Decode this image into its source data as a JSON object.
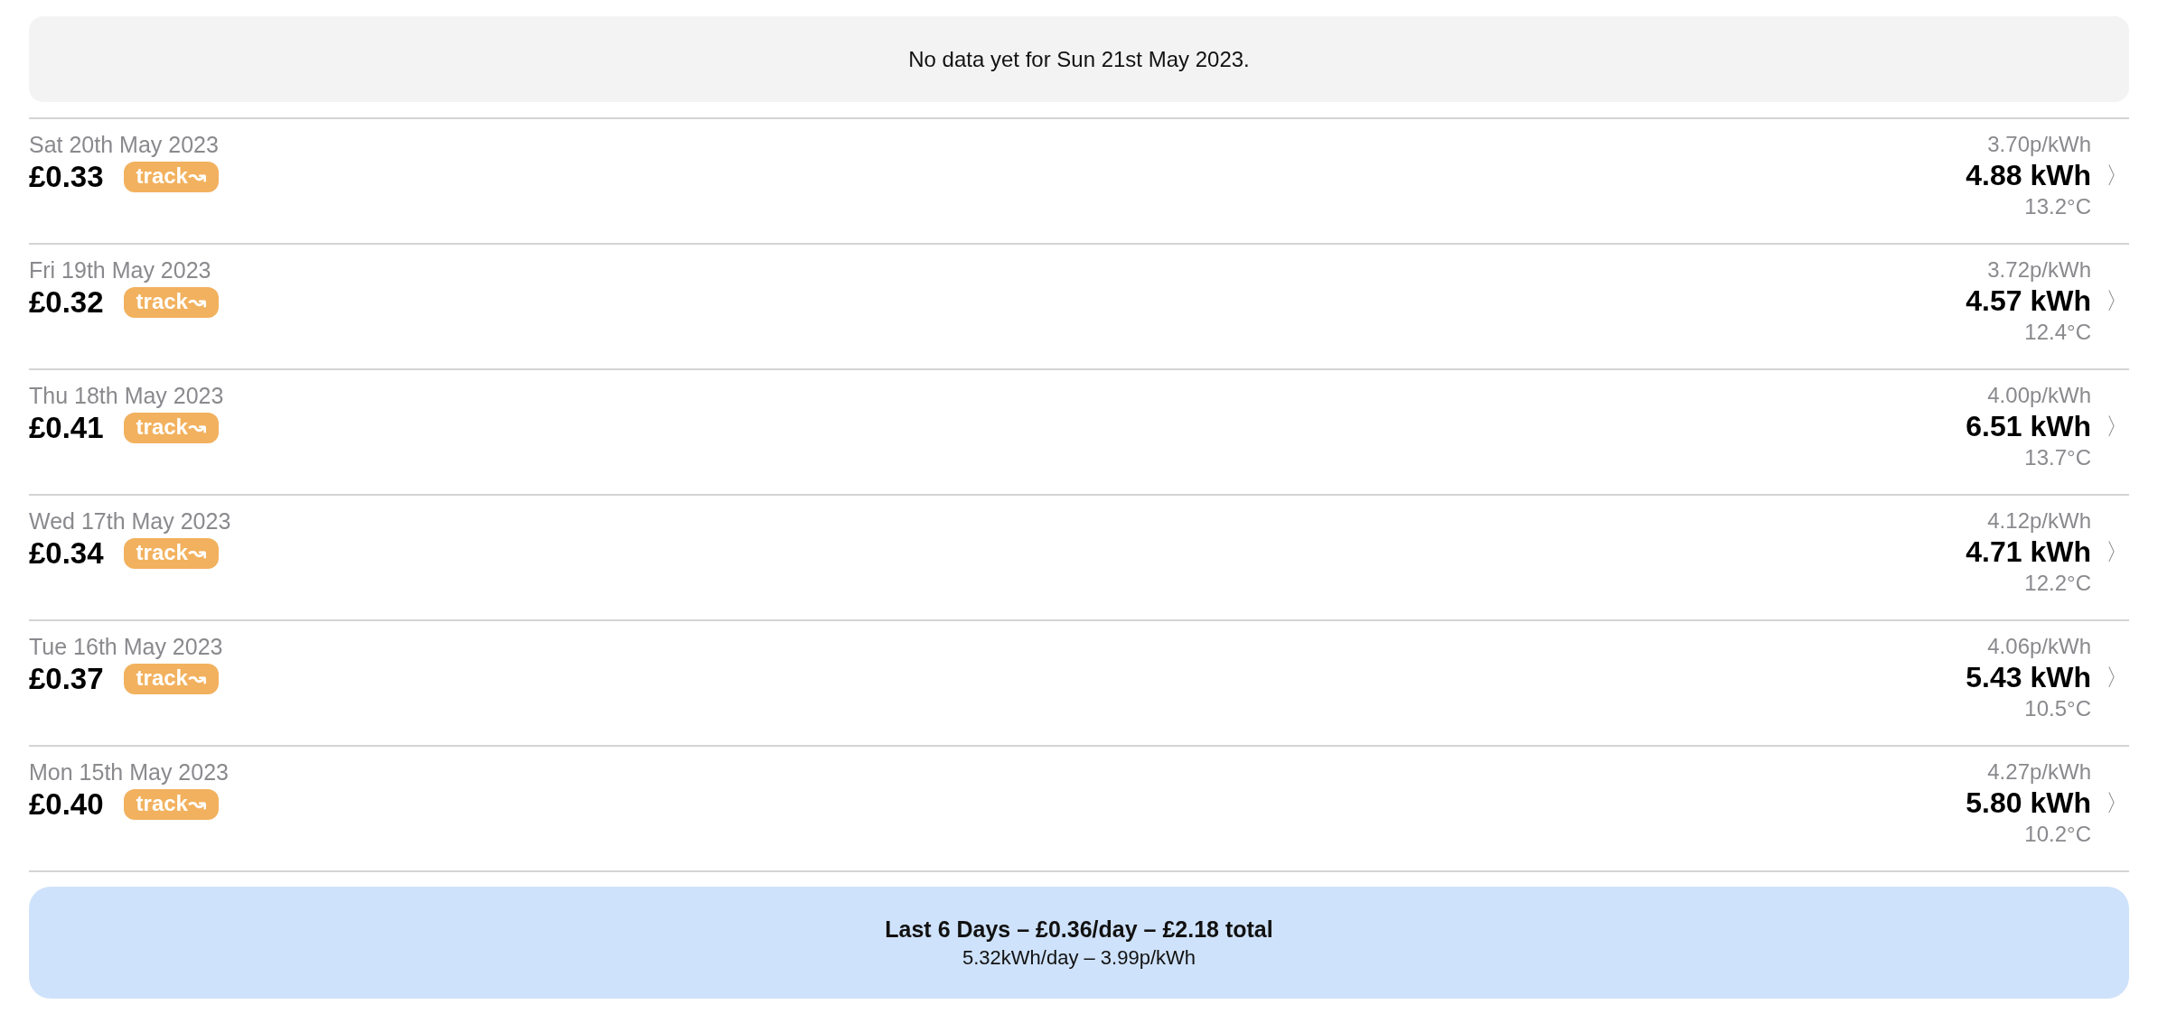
{
  "notice": "No data yet for Sun 21st May 2023.",
  "days": [
    {
      "date": "Sat 20th May 2023",
      "cost": "£0.33",
      "badge": "track↝",
      "rate": "3.70p/kWh",
      "usage": "4.88 kWh",
      "temperature": "13.2°C",
      "chevron": "〉"
    },
    {
      "date": "Fri 19th May 2023",
      "cost": "£0.32",
      "badge": "track↝",
      "rate": "3.72p/kWh",
      "usage": "4.57 kWh",
      "temperature": "12.4°C",
      "chevron": "〉"
    },
    {
      "date": "Thu 18th May 2023",
      "cost": "£0.41",
      "badge": "track↝",
      "rate": "4.00p/kWh",
      "usage": "6.51 kWh",
      "temperature": "13.7°C",
      "chevron": "〉"
    },
    {
      "date": "Wed 17th May 2023",
      "cost": "£0.34",
      "badge": "track↝",
      "rate": "4.12p/kWh",
      "usage": "4.71 kWh",
      "temperature": "12.2°C",
      "chevron": "〉"
    },
    {
      "date": "Tue 16th May 2023",
      "cost": "£0.37",
      "badge": "track↝",
      "rate": "4.06p/kWh",
      "usage": "5.43 kWh",
      "temperature": "10.5°C",
      "chevron": "〉"
    },
    {
      "date": "Mon 15th May 2023",
      "cost": "£0.40",
      "badge": "track↝",
      "rate": "4.27p/kWh",
      "usage": "5.80 kWh",
      "temperature": "10.2°C",
      "chevron": "〉"
    }
  ],
  "summary": {
    "headline": "Last 6 Days – £0.36/day – £2.18 total",
    "detail": "5.32kWh/day – 3.99p/kWh"
  }
}
